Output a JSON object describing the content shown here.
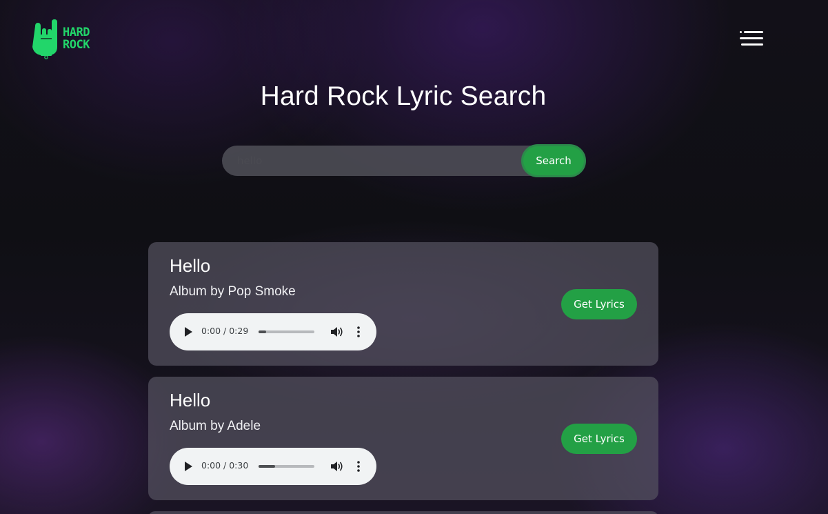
{
  "brand": {
    "logo_line1": "HARD",
    "logo_line2": "ROCK",
    "accent_color": "#22d66a"
  },
  "header": {
    "menu_icon": "hamburger-menu-icon"
  },
  "page": {
    "title": "Hard Rock Lyric Search"
  },
  "search": {
    "value": "hello",
    "button_label": "Search",
    "button_color": "#23a045"
  },
  "results": [
    {
      "title": "Hello",
      "artist_line": "Album by Pop Smoke",
      "time": "0:00 / 0:29",
      "progress": 0.14,
      "lyrics_label": "Get Lyrics"
    },
    {
      "title": "Hello",
      "artist_line": "Album by Adele",
      "time": "0:00 / 0:30",
      "progress": 0.3,
      "lyrics_label": "Get Lyrics"
    }
  ]
}
